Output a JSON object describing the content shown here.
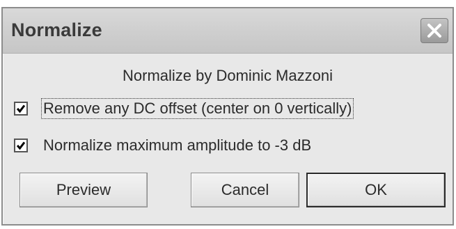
{
  "window": {
    "title": "Normalize",
    "close_icon": "close-icon"
  },
  "content": {
    "subtitle": "Normalize by Dominic Mazzoni"
  },
  "options": [
    {
      "label": "Remove any DC offset (center on 0 vertically)",
      "checked": true
    },
    {
      "label": "Normalize maximum amplitude to -3 dB",
      "checked": true
    }
  ],
  "buttons": {
    "preview": "Preview",
    "cancel": "Cancel",
    "ok": "OK"
  },
  "colors": {
    "dialog_bg": "#e8e8e8",
    "titlebar_bg": "#cfcfcf",
    "text": "#2b2b2b"
  }
}
